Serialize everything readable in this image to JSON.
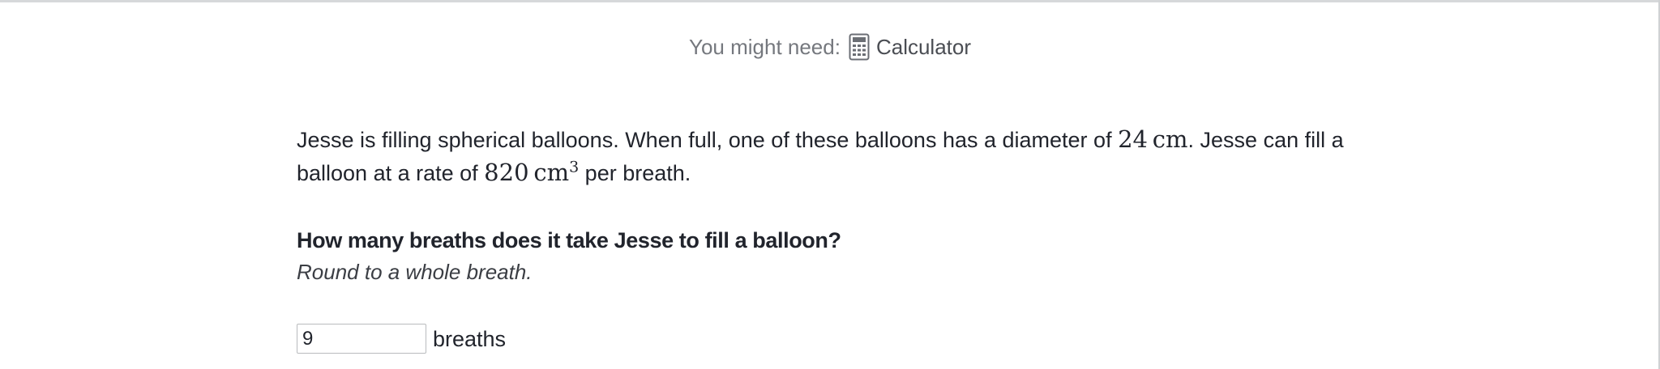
{
  "tools": {
    "label": "You might need:",
    "icon": "calculator-icon",
    "item": "Calculator"
  },
  "problem": {
    "text_1": "Jesse is filling spherical balloons. When full, one of these balloons has a diameter of ",
    "diameter_value": "24",
    "diameter_unit": "cm",
    "text_2": ". Jesse can fill a balloon at a rate of ",
    "rate_value": "820",
    "rate_unit": "cm",
    "rate_exponent": "3",
    "text_3": " per breath."
  },
  "question": {
    "title": "How many breaths does it take Jesse to fill a balloon?",
    "hint": "Round to a whole breath."
  },
  "answer": {
    "value": "9",
    "unit": "breaths"
  }
}
